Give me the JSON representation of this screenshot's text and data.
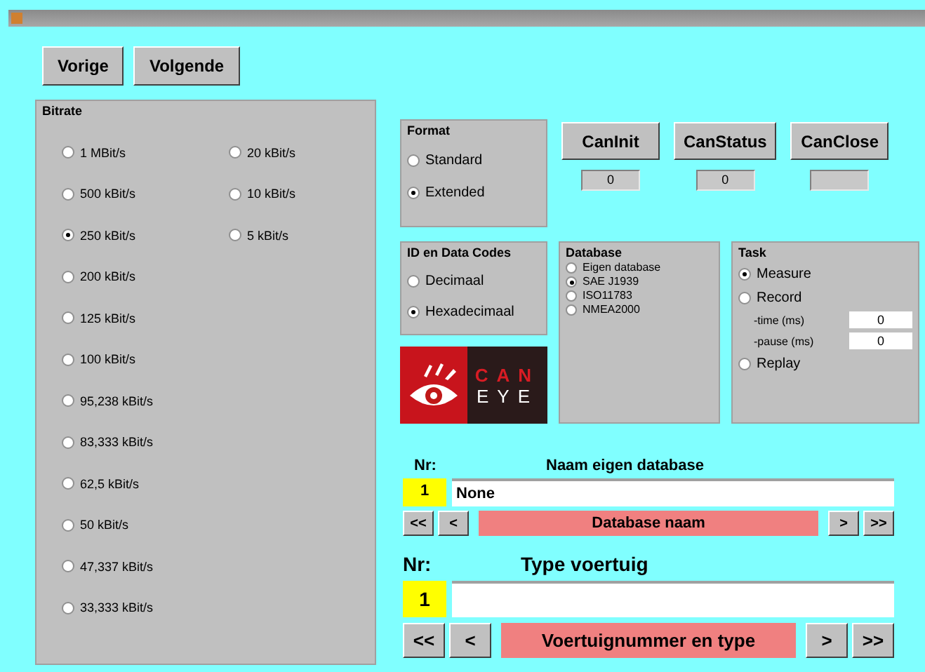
{
  "nav_buttons": [
    "Vorige",
    "Volgende"
  ],
  "bitrate": {
    "title": "Bitrate",
    "columns": [
      [
        {
          "label": "1 MBit/s",
          "selected": false
        },
        {
          "label": "500 kBit/s",
          "selected": false
        },
        {
          "label": "250 kBit/s",
          "selected": true
        },
        {
          "label": "200 kBit/s",
          "selected": false
        },
        {
          "label": "125 kBit/s",
          "selected": false
        },
        {
          "label": "100 kBit/s",
          "selected": false
        },
        {
          "label": "95,238 kBit/s",
          "selected": false
        },
        {
          "label": "83,333 kBit/s",
          "selected": false
        },
        {
          "label": "62,5 kBit/s",
          "selected": false
        },
        {
          "label": "50 kBit/s",
          "selected": false
        },
        {
          "label": "47,337 kBit/s",
          "selected": false
        },
        {
          "label": "33,333 kBit/s",
          "selected": false
        }
      ],
      [
        {
          "label": "20 kBit/s",
          "selected": false
        },
        {
          "label": "10 kBit/s",
          "selected": false
        },
        {
          "label": "5 kBit/s",
          "selected": false
        }
      ]
    ]
  },
  "format": {
    "title": "Format",
    "options": [
      {
        "label": "Standard",
        "selected": false
      },
      {
        "label": "Extended",
        "selected": true
      }
    ]
  },
  "can_buttons": [
    {
      "label": "CanInit",
      "value": "0"
    },
    {
      "label": "CanStatus",
      "value": "0"
    },
    {
      "label": "CanClose"
    }
  ],
  "id_codes": {
    "title": "ID en Data Codes",
    "options": [
      {
        "label": "Decimaal",
        "selected": false
      },
      {
        "label": "Hexadecimaal",
        "selected": true
      }
    ]
  },
  "logo": {
    "top": "CAN",
    "bottom": "EYE"
  },
  "database": {
    "title": "Database",
    "options": [
      {
        "label": "Eigen database",
        "selected": false
      },
      {
        "label": "SAE J1939",
        "selected": true
      },
      {
        "label": "ISO11783",
        "selected": false
      },
      {
        "label": "NMEA2000",
        "selected": false
      }
    ]
  },
  "task": {
    "title": "Task",
    "measure": {
      "label": "Measure",
      "selected": true
    },
    "record": {
      "label": "Record",
      "selected": false
    },
    "fields": [
      {
        "label": "-time (ms)",
        "value": "0"
      },
      {
        "label": "-pause (ms)",
        "value": "0"
      }
    ],
    "replay": {
      "label": "Replay",
      "selected": false
    }
  },
  "records": [
    {
      "nr_label": "Nr:",
      "heading": "Naam eigen database",
      "nr": "1",
      "value": "None",
      "nav": [
        "<<",
        "<"
      ],
      "caption": "Database naam",
      "nav_right": [
        ">",
        ">>"
      ],
      "kind": "small"
    },
    {
      "nr_label": "Nr:",
      "heading": "Type voertuig",
      "nr": "1",
      "nav": [
        "<<",
        "<"
      ],
      "caption": "Voertuignummer en type",
      "nav_right": [
        ">",
        ">>"
      ],
      "kind": "large"
    }
  ]
}
